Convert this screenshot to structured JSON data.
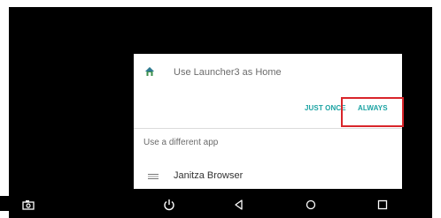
{
  "dialog": {
    "title": "Use Launcher3 as Home",
    "title_icon": "home-icon",
    "buttons": {
      "just_once": "JUST ONCE",
      "always": "ALWAYS"
    },
    "section_label": "Use a different app",
    "apps": [
      {
        "label": "Janitza Browser",
        "icon": "app-icon"
      }
    ]
  },
  "navbar": {
    "items": [
      "screenshot-icon",
      "power-icon",
      "back-icon",
      "home-circle-icon",
      "recents-icon"
    ]
  },
  "colors": {
    "accent": "#1ba3a3",
    "highlight": "#d9252a",
    "screen_background": "#000000",
    "dialog_background": "#ffffff"
  }
}
